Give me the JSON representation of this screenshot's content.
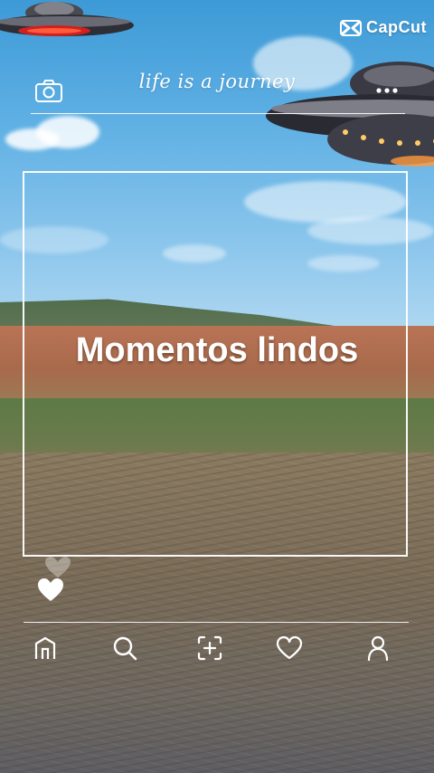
{
  "brand": {
    "logo_text": "CapCut",
    "logo_icon": "capcut-logo-icon"
  },
  "header": {
    "tagline": "life is a journey",
    "left_icon": "camera-icon",
    "right_icon": "more-dots-icon"
  },
  "main": {
    "title": "Momentos lindos"
  },
  "reactions": {
    "icon": "heart-icon"
  },
  "bottom_nav": {
    "items": [
      {
        "icon": "home-icon"
      },
      {
        "icon": "search-icon"
      },
      {
        "icon": "add-post-icon"
      },
      {
        "icon": "heart-icon"
      },
      {
        "icon": "profile-icon"
      }
    ]
  },
  "colors": {
    "overlay_text": "#ffffff",
    "sky": "#5fb0e4",
    "soil": "#b97355"
  }
}
